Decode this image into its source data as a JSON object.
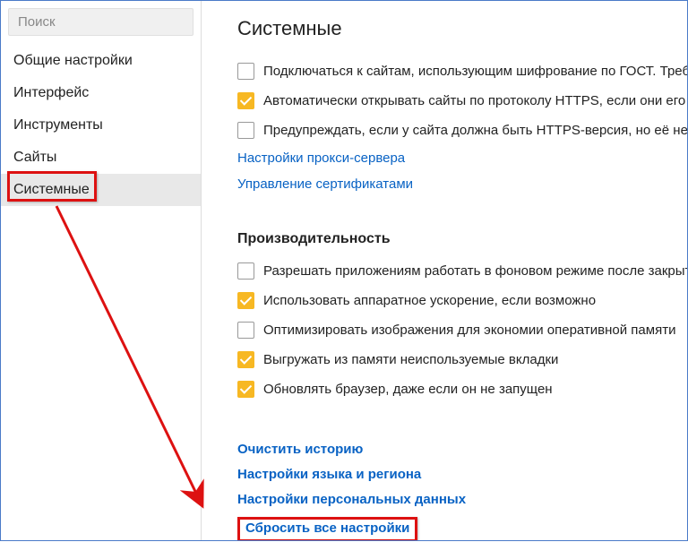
{
  "sidebar": {
    "search_placeholder": "Поиск",
    "items": [
      {
        "label": "Общие настройки"
      },
      {
        "label": "Интерфейс"
      },
      {
        "label": "Инструменты"
      },
      {
        "label": "Сайты"
      },
      {
        "label": "Системные"
      }
    ]
  },
  "content": {
    "title": "Системные",
    "system_checks": [
      {
        "checked": false,
        "label": "Подключаться к сайтам, использующим шифрование по ГОСТ. Требуе"
      },
      {
        "checked": true,
        "label": "Автоматически открывать сайты по протоколу HTTPS, если они его по"
      },
      {
        "checked": false,
        "label": "Предупреждать, если у сайта должна быть HTTPS-версия, но её нет"
      }
    ],
    "system_links": [
      "Настройки прокси-сервера",
      "Управление сертификатами"
    ],
    "perf_title": "Производительность",
    "perf_checks": [
      {
        "checked": false,
        "label": "Разрешать приложениям работать в фоновом режиме после закрыти"
      },
      {
        "checked": true,
        "label": "Использовать аппаратное ускорение, если возможно"
      },
      {
        "checked": false,
        "label": "Оптимизировать изображения для экономии оперативной памяти"
      },
      {
        "checked": true,
        "label": "Выгружать из памяти неиспользуемые вкладки"
      },
      {
        "checked": true,
        "label": "Обновлять браузер, даже если он не запущен"
      }
    ],
    "bottom_links": [
      "Очистить историю",
      "Настройки языка и региона",
      "Настройки персональных данных",
      "Сбросить все настройки"
    ]
  }
}
